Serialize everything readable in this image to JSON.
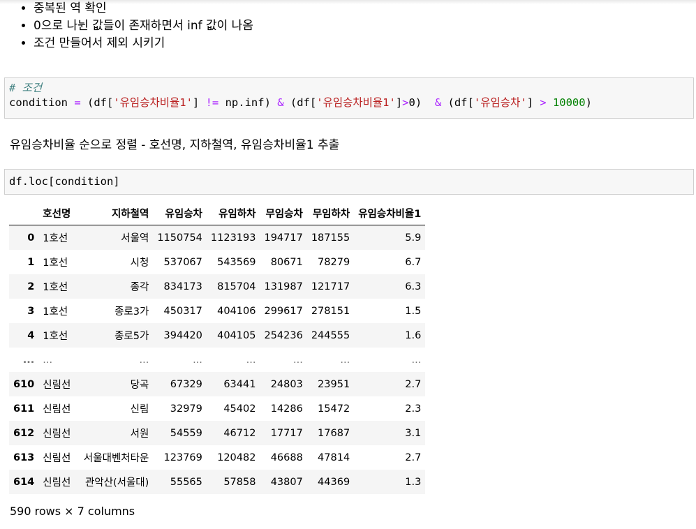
{
  "bullets": [
    "중복된 역 확인",
    "0으로 나뉜 값들이 존재하면서 inf 값이 나옴",
    "조건 만들어서 제외 시키기"
  ],
  "cell1": {
    "comment": "# 조건",
    "code_tokens": [
      "condition ",
      "=",
      " (df[",
      "'유임승차비율1'",
      "] ",
      "!=",
      " np.inf) ",
      "&",
      " (df[",
      "'유임승차비율1'",
      "]",
      ">",
      "0)  ",
      "&",
      " (df[",
      "'유임승차'",
      "] ",
      ">",
      " ",
      "10000",
      ")"
    ]
  },
  "markdown_text": "유임승차비율 순으로 정렬 - 호선명, 지하철역, 유임승차비율1 추출",
  "cell2": {
    "code": "df.loc[condition]"
  },
  "table": {
    "columns": [
      "",
      "호선명",
      "지하철역",
      "유임승차",
      "유임하차",
      "무임승차",
      "무임하차",
      "유임승차비율1"
    ],
    "rows": [
      [
        "0",
        "1호선",
        "서울역",
        "1150754",
        "1123193",
        "194717",
        "187155",
        "5.9"
      ],
      [
        "1",
        "1호선",
        "시청",
        "537067",
        "543569",
        "80671",
        "78279",
        "6.7"
      ],
      [
        "2",
        "1호선",
        "종각",
        "834173",
        "815704",
        "131987",
        "121717",
        "6.3"
      ],
      [
        "3",
        "1호선",
        "종로3가",
        "450317",
        "404106",
        "299617",
        "278151",
        "1.5"
      ],
      [
        "4",
        "1호선",
        "종로5가",
        "394420",
        "404105",
        "254236",
        "244555",
        "1.6"
      ],
      [
        "...",
        "...",
        "...",
        "...",
        "...",
        "...",
        "...",
        "..."
      ],
      [
        "610",
        "신림선",
        "당곡",
        "67329",
        "63441",
        "24803",
        "23951",
        "2.7"
      ],
      [
        "611",
        "신림선",
        "신림",
        "32979",
        "45402",
        "14286",
        "15472",
        "2.3"
      ],
      [
        "612",
        "신림선",
        "서원",
        "54559",
        "46712",
        "17717",
        "17687",
        "3.1"
      ],
      [
        "613",
        "신림선",
        "서울대벤처타운",
        "123769",
        "120482",
        "46688",
        "47814",
        "2.7"
      ],
      [
        "614",
        "신림선",
        "관악산(서울대)",
        "55565",
        "57858",
        "43807",
        "44369",
        "1.3"
      ]
    ],
    "summary": "590 rows × 7 columns"
  }
}
